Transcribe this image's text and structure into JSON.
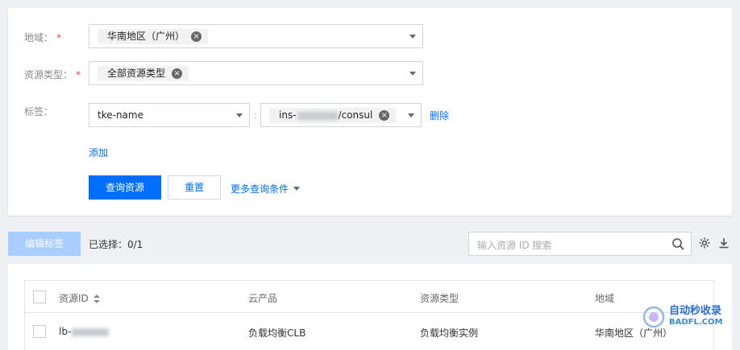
{
  "filters": {
    "region": {
      "label": "地域：",
      "required_mark": "*",
      "selected": "华南地区（广州）"
    },
    "resource_type": {
      "label": "资源类型：",
      "required_mark": "*",
      "selected": "全部资源类型"
    },
    "tag": {
      "label": "标签：",
      "key": "tke-name",
      "separator": ":",
      "value_prefix": "ins-",
      "value_suffix": "/consul",
      "delete_label": "删除"
    },
    "add_label": "添加",
    "query_label": "查询资源",
    "reset_label": "重置",
    "more_label": "更多查询条件"
  },
  "toolbar": {
    "edit_tags_label": "编辑标签",
    "selected_text": "已选择：0/1",
    "search_placeholder": "输入资源 ID 搜索"
  },
  "table": {
    "columns": [
      "资源ID",
      "云产品",
      "资源类型",
      "地域"
    ],
    "rows": [
      {
        "id_prefix": "lb-",
        "product": "负载均衡CLB",
        "type": "负载均衡实例",
        "region": "华南地区（广州）"
      }
    ]
  },
  "watermark": {
    "line1": "自动秒收录",
    "line2": "BADFL.COM"
  },
  "colors": {
    "primary": "#006eff",
    "disabled": "#a9cdff",
    "required": "#e54545"
  }
}
